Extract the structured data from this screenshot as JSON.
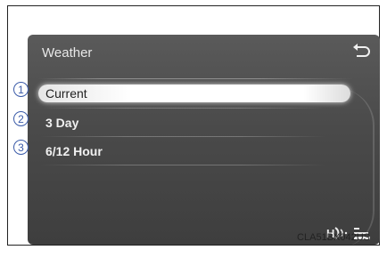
{
  "screen": {
    "title": "Weather",
    "back_icon": "back-arrow-icon"
  },
  "menu": {
    "items": [
      {
        "badge": "1",
        "label": "Current",
        "selected": true
      },
      {
        "badge": "2",
        "label": "3 Day",
        "selected": false
      },
      {
        "badge": "3",
        "label": "6/12 Hour",
        "selected": false
      }
    ]
  },
  "status": {
    "hd_icon": "hd-radio-icon",
    "list_icon": "list-icon"
  },
  "caption": {
    "code": "CLA51BX042US"
  },
  "colors": {
    "screen_bg": "#4a4a4a",
    "text": "#f0f0f0",
    "selected_bg": "#ffffff",
    "badge": "#3a5aa8"
  }
}
